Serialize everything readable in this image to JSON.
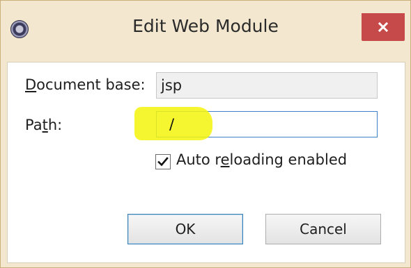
{
  "window": {
    "title": "Edit Web Module",
    "icons": {
      "app": "gear-icon",
      "close": "close-icon"
    },
    "colors": {
      "frame": "#f3e8cf",
      "close_button": "#c64a4a",
      "focus_border": "#3d7fc9",
      "highlight": "#f4f40c"
    }
  },
  "form": {
    "document_base": {
      "label_mnemonic": "D",
      "label_rest": "ocument base:",
      "value": "jsp"
    },
    "path": {
      "label_pre": "Pa",
      "label_mnemonic": "t",
      "label_rest": "h:",
      "value": "/"
    },
    "auto_reload": {
      "label_pre": "Auto r",
      "label_mnemonic": "e",
      "label_rest": "loading enabled",
      "checked": true
    }
  },
  "buttons": {
    "ok": "OK",
    "cancel": "Cancel"
  }
}
